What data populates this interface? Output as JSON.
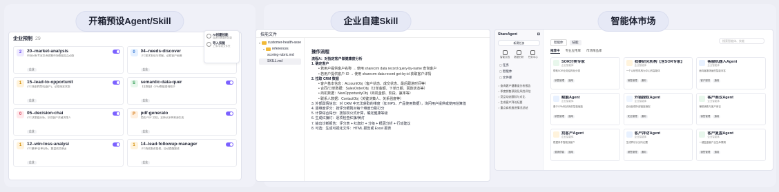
{
  "panels": {
    "left_title": "开箱预设Agent/Skill",
    "middle_title": "企业自建Skill",
    "right_title": "智能体市场"
  },
  "skills": {
    "header": "企业预制",
    "count": "29",
    "float_items": [
      {
        "title": "AI创建技能",
        "sub": "描述你需要的技能"
      },
      {
        "title": "导入技能",
        "sub": "上传zip或文件夹"
      }
    ],
    "cards": [
      {
        "num": "2",
        "title": "20–market-analysis",
        "desc": "市场分析专家负责收集市场数据竞品动态",
        "tag": "企业"
      },
      {
        "num": "0",
        "title": "04–needs-discover",
        "desc": "LTC需求发现与挖掘，读取客户画像",
        "tag": "企业"
      },
      {
        "num": "1",
        "title": "15–lead-to-opportunit",
        "desc": "LTC线索转商机(客户)，读取线索状态",
        "tag": "企业"
      },
      {
        "num": "S",
        "title": "semantic-data-quer",
        "desc": "【主数据】CRM数据查询助手",
        "tag": "企业"
      },
      {
        "num": "0",
        "title": "05–decision-chai",
        "desc": "LTC决策链分析，识别客户关键决策人",
        "tag": "企业"
      },
      {
        "num": "P",
        "title": "pdf-generato",
        "desc": "完成 PDF 文档，支持从多种来源生成",
        "tag": "企业"
      },
      {
        "num": "1",
        "title": "12–win-loss-analysi",
        "desc": "LTC赢单/丢单分析，复盘成交原因",
        "tag": "企业"
      },
      {
        "num": "1",
        "title": "14–lead-followup-manager",
        "desc": "LTC线索跟进管理，自动提醒跟进",
        "tag": "企业"
      }
    ]
  },
  "files": {
    "header": "技能文件",
    "tree": [
      {
        "label": "customer-health-asse",
        "kind": "folder"
      },
      {
        "label": "references",
        "kind": "folder"
      },
      {
        "label": "scoring-rubric.md",
        "kind": "file"
      },
      {
        "label": "SKILL.md",
        "kind": "file"
      }
    ],
    "doc_title": "操作流程",
    "lines": [
      {
        "t": "流程A：对指定客户做健康度分析",
        "k": "b"
      },
      {
        "t": "1. 确定客户",
        "k": "b"
      },
      {
        "t": "若用户提供客户名称 → 使用 sharecrm data record query-by-name 查询客户",
        "k": "s"
      },
      {
        "t": "若用户提供客户 ID → 使用 sharecrm data record get-by-id 获取客户详情",
        "k": "s"
      },
      {
        "t": "2. 拉取 CRM 数据",
        "k": "b"
      },
      {
        "t": "客户基本信息：AccountObj（客户状态、成交状态、最后跟进时间等）",
        "k": "s"
      },
      {
        "t": "合同/订单数据：SalesOrderObj（订单金额、下单日期、回款状态等）",
        "k": "s"
      },
      {
        "t": "商机数据：NewOpportunityObj（商机金额、阶段、赢率等）",
        "k": "s"
      },
      {
        "t": "联系人数据：ContactObj（关键决策人、关系强度等）",
        "k": "s"
      },
      {
        "t": "3. 外部舆情信息：对 CRM 中无法获取的维度（如 NPS、产品使用数据），询问用户提供或使用估算值",
        "k": "n"
      },
      {
        "t": "4. 逐维度评分：按评分细则对每个维度分别打分",
        "k": "n"
      },
      {
        "t": "5. 计算综合得分：按加权公式计算，确定健康等级",
        "k": "n"
      },
      {
        "t": "6. 生成红旗灯：逐项检查红旗/黄灯",
        "k": "n"
      },
      {
        "t": "7. 输出诊断报告：评分表 + 红旗灯 + 分级 + 根因分析 + 行动建议",
        "k": "n"
      },
      {
        "t": "8. 可选：生成可视化文件：HTML 报告或 Excel 报表",
        "k": "n"
      }
    ]
  },
  "market": {
    "brand": "ShareAgent",
    "new_task": "新建任务",
    "quick": [
      "智能文档",
      "数据分析",
      "任务中心"
    ],
    "nav": [
      "任务",
      "智能体",
      "文件库"
    ],
    "history": [
      "查询客户健康度分析报告",
      "季度销售预测及风险评估",
      "竞品动态跟踪与对比",
      "生成客户拜访纪要",
      "重点商机推进情况总结"
    ],
    "top_tabs": [
      "智能体",
      "技能"
    ],
    "search_placeholder": "搜索智能体、技能",
    "sub_tabs": [
      "推荐中",
      "专业应用库",
      "市场精品库"
    ],
    "agents": [
      {
        "title": "SOR分类专家",
        "sub": "企业智能体",
        "desc": "帮助SOR业务结构化分类",
        "tags": [
          "销售管理",
          "通用"
        ],
        "color": "#e8f7ec"
      },
      {
        "title": "我要研究机构【含SOR专家】",
        "sub": "企业智能体",
        "desc": "一个以研究机构为中心的智能体",
        "tags": [
          "销售管理",
          "通用"
        ],
        "color": "#fff3dc"
      },
      {
        "title": "客服机器人Agent",
        "sub": "企业智能体",
        "desc": "面向客服场景的智能问答",
        "tags": [
          "客户服务",
          "通用"
        ],
        "color": "#e8f1ff"
      },
      {
        "title": "赋能Agent",
        "sub": "企业智能体",
        "desc": "基于CRM知识库的智能赋能",
        "tags": [
          "销售管理",
          "通用"
        ],
        "color": "#e8f1ff"
      },
      {
        "title": "外链授权Agent",
        "sub": "企业智能体",
        "desc": "自动处理外部链接授权",
        "tags": [
          "安全管理",
          "通用"
        ],
        "color": "#eef5ff"
      },
      {
        "title": "客户商议Agent",
        "sub": "企业智能体",
        "desc": "辅助销售与客户商议",
        "tags": [
          "销售管理",
          "通用"
        ],
        "color": "#e8f7ec"
      },
      {
        "title": "找客户Agent",
        "sub": "企业智能体",
        "desc": "根据条件智能找客户",
        "tags": [
          "营销获客",
          "通用"
        ],
        "color": "#fff3dc"
      },
      {
        "title": "客户拜访Agent",
        "sub": "企业智能体",
        "desc": "生成拜访计划与纪要",
        "tags": [
          "销售管理",
          "通用"
        ],
        "color": "#e8f1ff"
      },
      {
        "title": "客户复盘Agent",
        "sub": "企业智能体",
        "desc": "一键复盘客户全生命周期",
        "tags": [
          "销售管理",
          "通用"
        ],
        "color": "#e8f7ec"
      }
    ]
  },
  "colors": {
    "accent": "#7b61ff",
    "panel_bg": "#f0f1f8",
    "page_bg": "#ecedf4"
  }
}
